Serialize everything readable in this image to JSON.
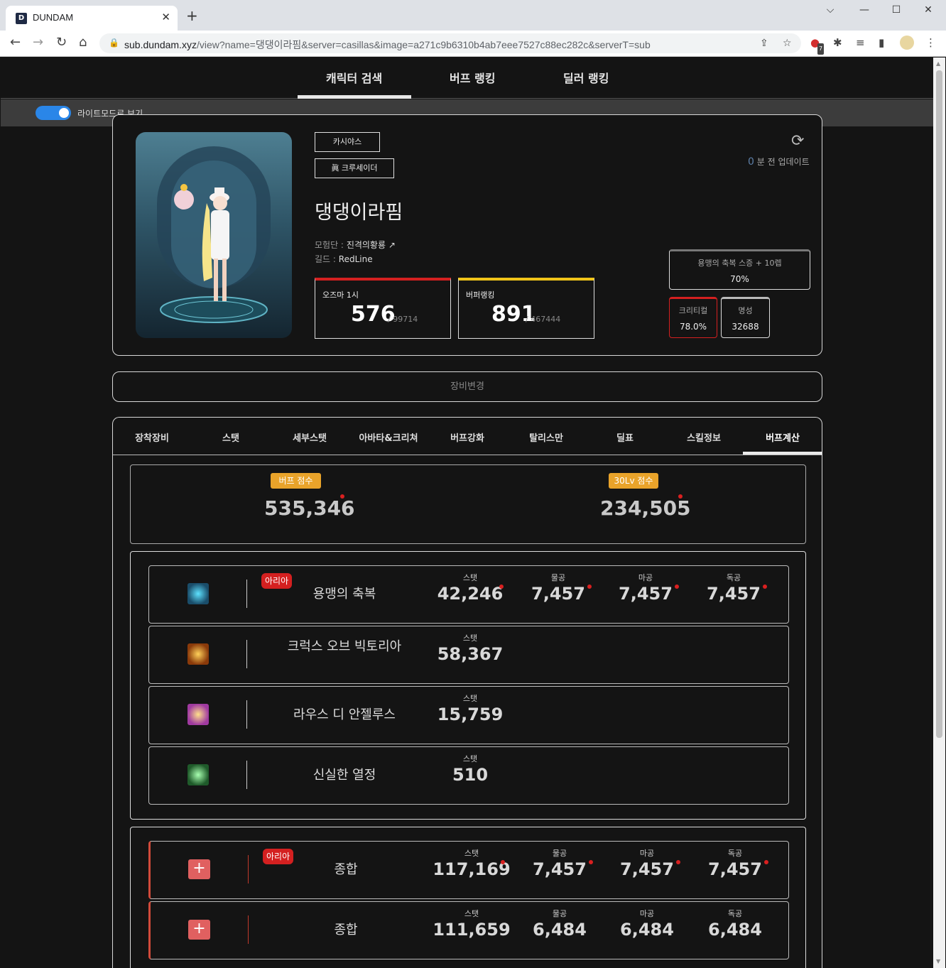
{
  "browser": {
    "tab_title": "DUNDAM",
    "favicon_letter": "D",
    "url_host": "sub.dundam.xyz",
    "url_path": "/view?name=댕댕이라핌&server=casillas&image=a271c9b6310b4ab7eee7527c88ec282c&serverT=sub",
    "ext_badge": "7"
  },
  "nav": {
    "items": [
      "캐릭터 검색",
      "버프 랭킹",
      "딜러 랭킹"
    ],
    "active": "캐릭터 검색"
  },
  "lightmode": {
    "label": "라이트모드로 보기",
    "enabled": true
  },
  "profile": {
    "server_tag": "카시야스",
    "class_tag": "眞 크루세이더",
    "name": "댕댕이라핌",
    "adventure_label": "모험단 :",
    "adventure_value": "진격의황룡",
    "guild_label": "길드 :",
    "guild_value": "RedLine",
    "update_num": "0",
    "update_text": "분 전 업데이트",
    "ozma": {
      "label": "오즈마 1시",
      "rank": "576",
      "total": "/ 99714",
      "color": "#d42020"
    },
    "buffer": {
      "label": "버퍼랭킹",
      "rank": "891",
      "total": "/ 467444",
      "color": "#f0c419"
    },
    "blessing": {
      "label": "용맹의 축복 스증 + 10렙",
      "value": "70%"
    },
    "crit": {
      "label": "크리티컬",
      "value": "78.0%"
    },
    "fame": {
      "label": "명성",
      "value": "32688"
    }
  },
  "equip_change": "장비변경",
  "tabs": [
    "장착장비",
    "스탯",
    "세부스탯",
    "아바타&크리쳐",
    "버프강화",
    "탈리스만",
    "딜표",
    "스킬정보",
    "버프계산"
  ],
  "active_tab": "버프계산",
  "scores": {
    "buff_label": "버프 점수",
    "buff_value": "535,346",
    "lv30_label": "30Lv 점수",
    "lv30_value": "234,505"
  },
  "skills": [
    {
      "name": "용맹의 축복",
      "aria": "아리아",
      "icon": "sword-icon",
      "stat": "42,246",
      "phys": "7,457",
      "mag": "7,457",
      "ind": "7,457"
    },
    {
      "name": "크럭스 오브 빅토리아",
      "icon": "crux-icon",
      "stat": "58,367"
    },
    {
      "name": "라우스 디 안젤루스",
      "icon": "angel-icon",
      "stat": "15,759"
    },
    {
      "name": "신실한 열정",
      "icon": "passion-icon",
      "stat": "510"
    }
  ],
  "col_headers": {
    "stat": "스탯",
    "phys": "물공",
    "mag": "마공",
    "ind": "독공"
  },
  "totals": [
    {
      "name": "종합",
      "aria": "아리아",
      "stat": "117,169",
      "phys": "7,457",
      "mag": "7,457",
      "ind": "7,457"
    },
    {
      "name": "종합",
      "stat": "111,659",
      "phys": "6,484",
      "mag": "6,484",
      "ind": "6,484"
    }
  ],
  "colors": {
    "accent_blue": "#2a86e8",
    "badge_orange": "#e9a32a",
    "aria_red": "#d42020",
    "dot_red": "#d92020"
  }
}
